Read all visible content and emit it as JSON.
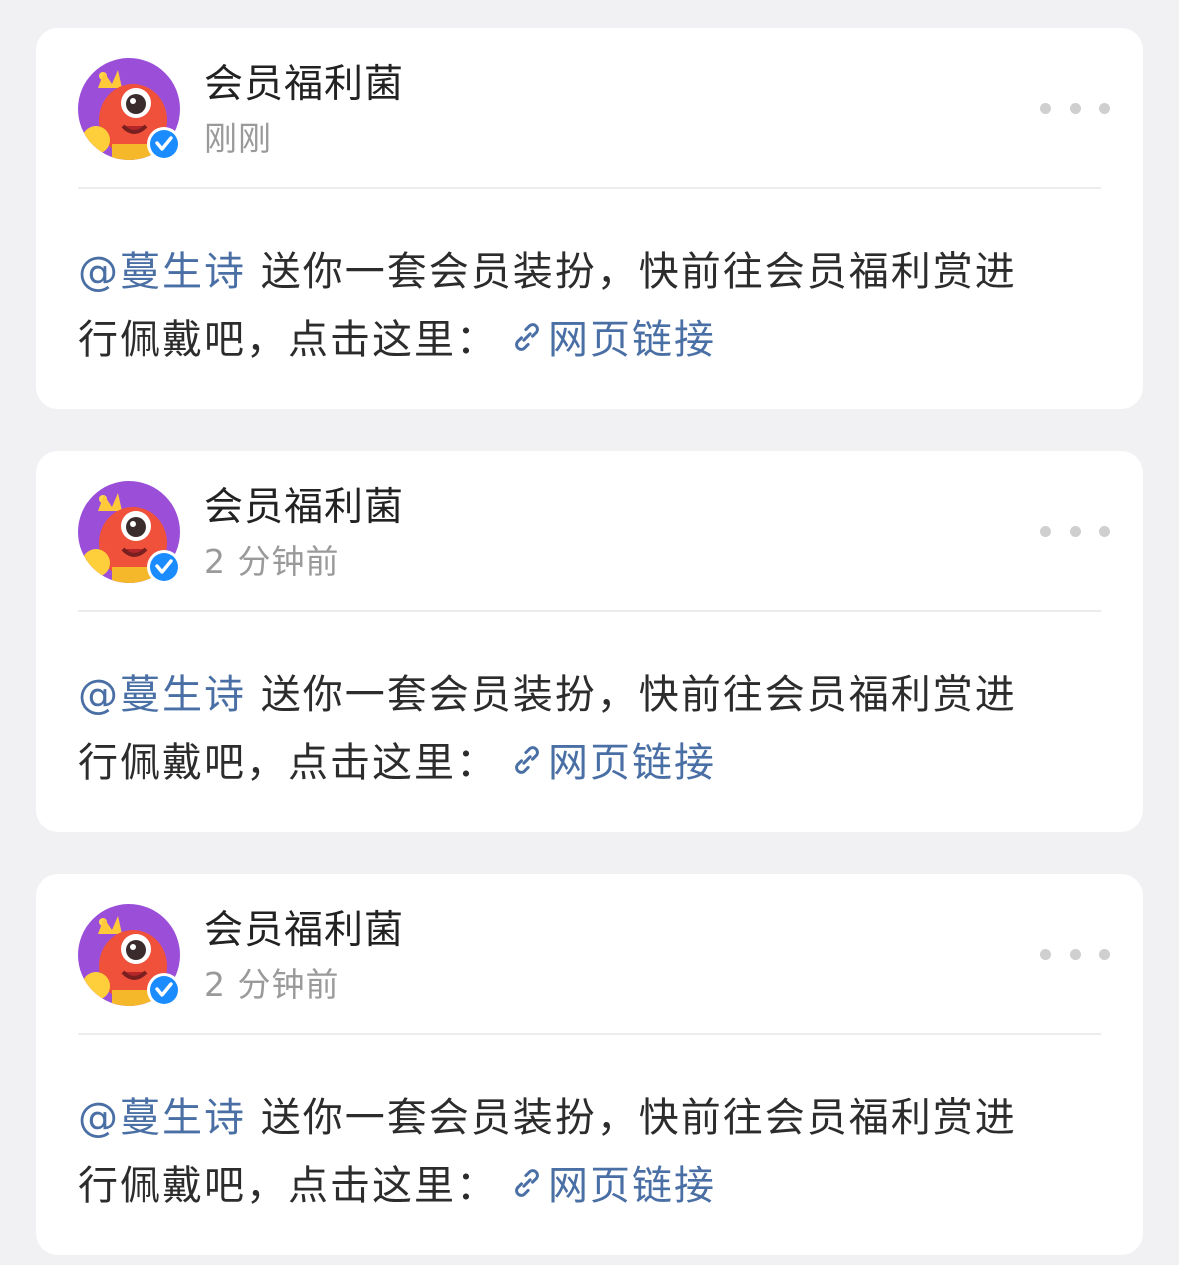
{
  "posts": [
    {
      "author": "会员福利菌",
      "time": "刚刚",
      "mention": "@蔓生诗",
      "text_line1": " 送你一套会员装扮，快前往会员福利赏进",
      "text_line2": "行佩戴吧，点击这里：",
      "link_label": "网页链接",
      "avatar_icon": "cartoon-mascot-avatar",
      "badge_icon": "verified-check-icon"
    },
    {
      "author": "会员福利菌",
      "time": "2 分钟前",
      "mention": "@蔓生诗",
      "text_line1": " 送你一套会员装扮，快前往会员福利赏进",
      "text_line2": "行佩戴吧，点击这里：",
      "link_label": "网页链接",
      "avatar_icon": "cartoon-mascot-avatar",
      "badge_icon": "verified-check-icon"
    },
    {
      "author": "会员福利菌",
      "time": "2 分钟前",
      "mention": "@蔓生诗",
      "text_line1": " 送你一套会员装扮，快前往会员福利赏进",
      "text_line2": "行佩戴吧，点击这里：",
      "link_label": "网页链接",
      "avatar_icon": "cartoon-mascot-avatar",
      "badge_icon": "verified-check-icon"
    }
  ],
  "colors": {
    "background": "#f1f1f3",
    "card": "#ffffff",
    "link": "#4a6fa5",
    "verified": "#1a8cff",
    "muted": "#9a9a9a"
  }
}
